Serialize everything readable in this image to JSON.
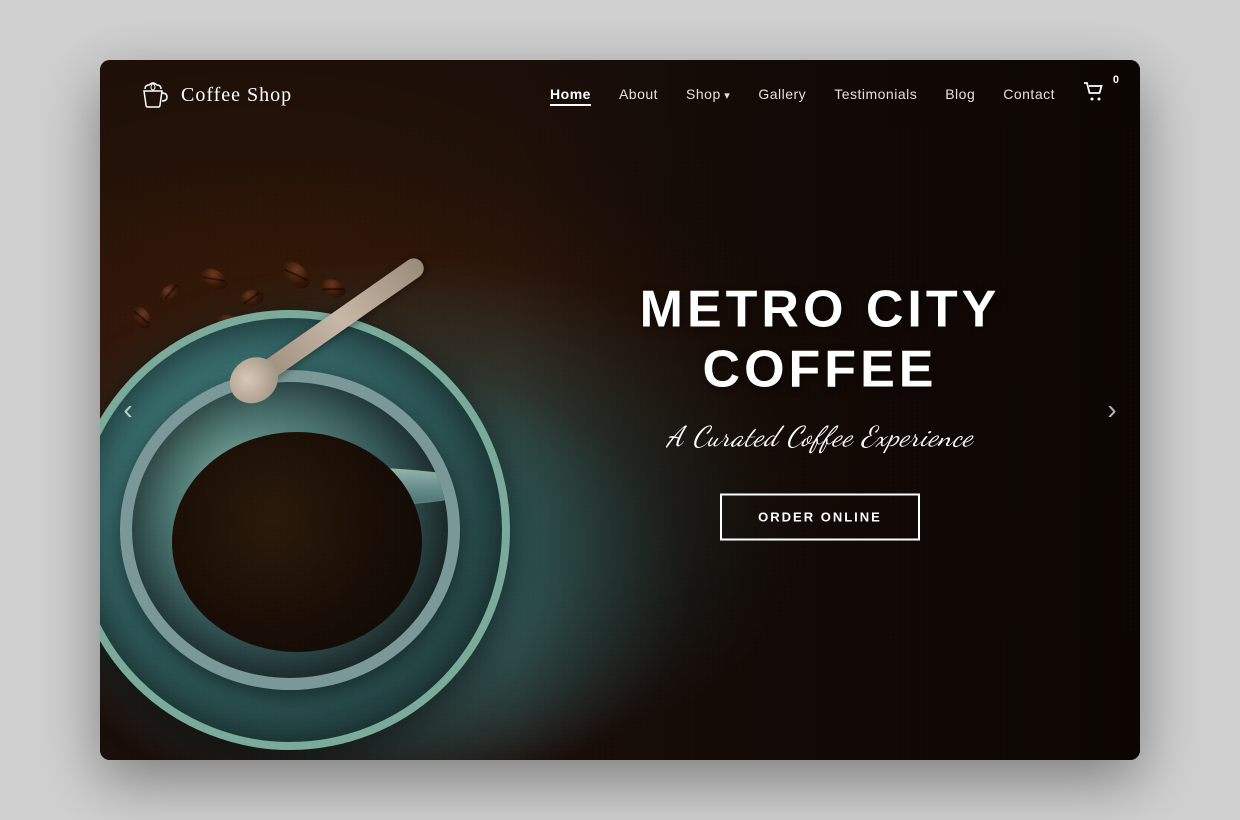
{
  "site": {
    "title": "Coffee Shop",
    "logo_text": "Coffee Shop"
  },
  "nav": {
    "links": [
      {
        "id": "home",
        "label": "Home",
        "active": true,
        "has_dropdown": false
      },
      {
        "id": "about",
        "label": "About",
        "active": false,
        "has_dropdown": false
      },
      {
        "id": "shop",
        "label": "Shop",
        "active": false,
        "has_dropdown": true
      },
      {
        "id": "gallery",
        "label": "Gallery",
        "active": false,
        "has_dropdown": false
      },
      {
        "id": "testimonials",
        "label": "Testimonials",
        "active": false,
        "has_dropdown": false
      },
      {
        "id": "blog",
        "label": "Blog",
        "active": false,
        "has_dropdown": false
      },
      {
        "id": "contact",
        "label": "Contact",
        "active": false,
        "has_dropdown": false
      }
    ],
    "cart_count": "0"
  },
  "hero": {
    "title": "METRO CITY COFFEE",
    "subtitle": "A Curated Coffee Experience",
    "cta_label": "ORDER ONLINE"
  },
  "carousel": {
    "prev_label": "‹",
    "next_label": "›"
  }
}
